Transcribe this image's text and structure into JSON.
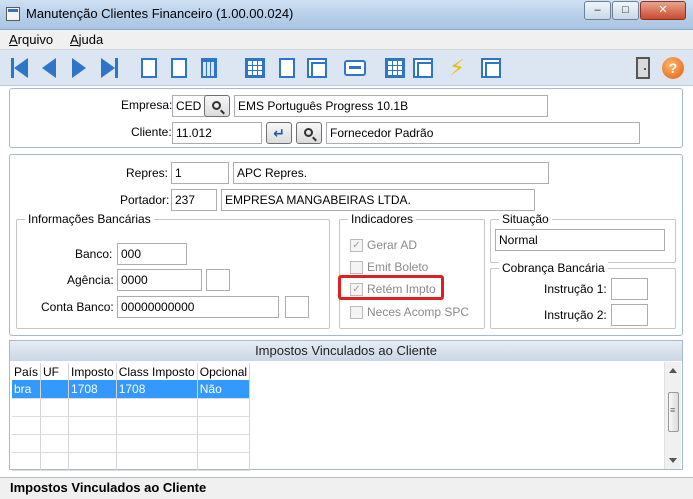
{
  "window": {
    "title": "Manutenção Clientes Financeiro (1.00.00.024)",
    "controls": {
      "minimize": "–",
      "maximize": "□",
      "close": "✕"
    }
  },
  "menu": [
    {
      "label": "Arquivo",
      "accel": "A",
      "rest": "rquivo"
    },
    {
      "label": "Ajuda",
      "accel": "A",
      "rest": "juda"
    }
  ],
  "toolbar": {
    "icons": [
      "first-icon",
      "previous-icon",
      "next-icon",
      "last-icon",
      "add-icon",
      "edit-icon",
      "delete-icon",
      "grid-icon",
      "new-document-icon",
      "preview-icon",
      "print-icon",
      "list-icon",
      "copy-icon",
      "lightning-icon",
      "import-icon",
      "exit-icon",
      "help-icon"
    ],
    "help_glyph": "?",
    "lightning_glyph": "⚡"
  },
  "header": {
    "empresa": {
      "label": "Empresa:",
      "code": "CED",
      "name": "EMS Português Progress 10.1B"
    },
    "cliente": {
      "label": "Cliente:",
      "code": "11.012",
      "name": "Fornecedor Padrão",
      "enter_glyph": "↵"
    }
  },
  "details": {
    "repres": {
      "label": "Repres:",
      "code": "1",
      "name": "APC Repres."
    },
    "portador": {
      "label": "Portador:",
      "code": "237",
      "name": "EMPRESA MANGABEIRAS LTDA."
    }
  },
  "bancarias": {
    "title": "Informações Bancárias",
    "banco": {
      "label": "Banco:",
      "value": "000"
    },
    "agencia": {
      "label": "Agência:",
      "value": "0000",
      "digit": ""
    },
    "conta": {
      "label": "Conta Banco:",
      "value": "00000000000",
      "digit": ""
    }
  },
  "indicadores": {
    "title": "Indicadores",
    "items": [
      {
        "label": "Gerar AD",
        "checked": true
      },
      {
        "label": "Emit Boleto",
        "checked": false
      },
      {
        "label": "Retém Impto",
        "checked": true
      },
      {
        "label": "Neces Acomp SPC",
        "checked": false
      }
    ],
    "check_glyph": "✓"
  },
  "situacao": {
    "title": "Situação",
    "value": "Normal"
  },
  "cobranca": {
    "title": "Cobrança Bancária",
    "instrucao1": {
      "label": "Instrução 1:",
      "value": ""
    },
    "instrucao2": {
      "label": "Instrução 2:",
      "value": ""
    }
  },
  "impostos": {
    "title": "Impostos Vinculados ao Cliente",
    "columns": [
      "País",
      "UF",
      "Imposto",
      "Class Imposto",
      "Opcional"
    ],
    "rows": [
      [
        "bra",
        "",
        "1708",
        "1708",
        "Não"
      ]
    ]
  },
  "status": "Impostos Vinculados ao Cliente"
}
